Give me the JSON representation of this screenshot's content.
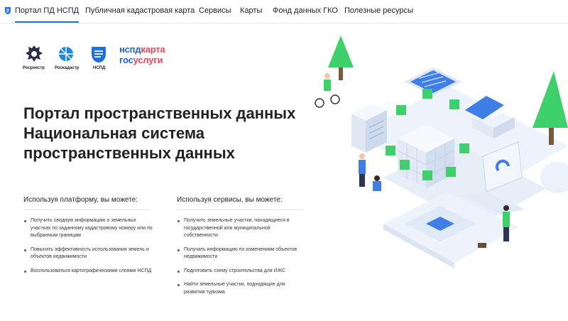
{
  "nav": {
    "items": [
      {
        "label": "Портал ПД НСПД"
      },
      {
        "label": "Публичная кадастровая карта"
      },
      {
        "label": "Сервисы"
      },
      {
        "label": "Карты"
      },
      {
        "label": "Фонд данных ГКО"
      },
      {
        "label": "Полезные ресурсы"
      }
    ]
  },
  "logos": {
    "rosreestr": "Росреестр",
    "roskadastr": "Роскадастр",
    "nspd": "НСПД",
    "gos_line1_a": "нспд",
    "gos_line1_b": "карта",
    "gos_line2_a": "гос",
    "gos_line2_b": "услуги"
  },
  "hero": {
    "title": "Портал пространственных данных Национальная система пространственных данных"
  },
  "columns": [
    {
      "heading": "Используя платформу, вы можете:",
      "items": [
        "Получить сводную информацию о земельных участках по заданному кадастровому номеру или по выбранным границам",
        "Повысить эффективность использования земель и объектов недвижимости",
        "Воспользоваться картографическими слоями НСПД"
      ]
    },
    {
      "heading": "Используя сервисы, вы можете:",
      "items": [
        "Получить земельные участки, находящиеся в государственной или муниципальной собственности",
        "Получать информацию по изменениям объектов недвижимости",
        "Подготовить схему строительства для ИЖС",
        "Найти земельные участки, подходящие для развития туризма"
      ]
    }
  ],
  "colors": {
    "accent": "#1f6fe0",
    "brand_red": "#e8455f",
    "brand_blue": "#1f5fd6",
    "tree_green": "#3fcf6b"
  }
}
